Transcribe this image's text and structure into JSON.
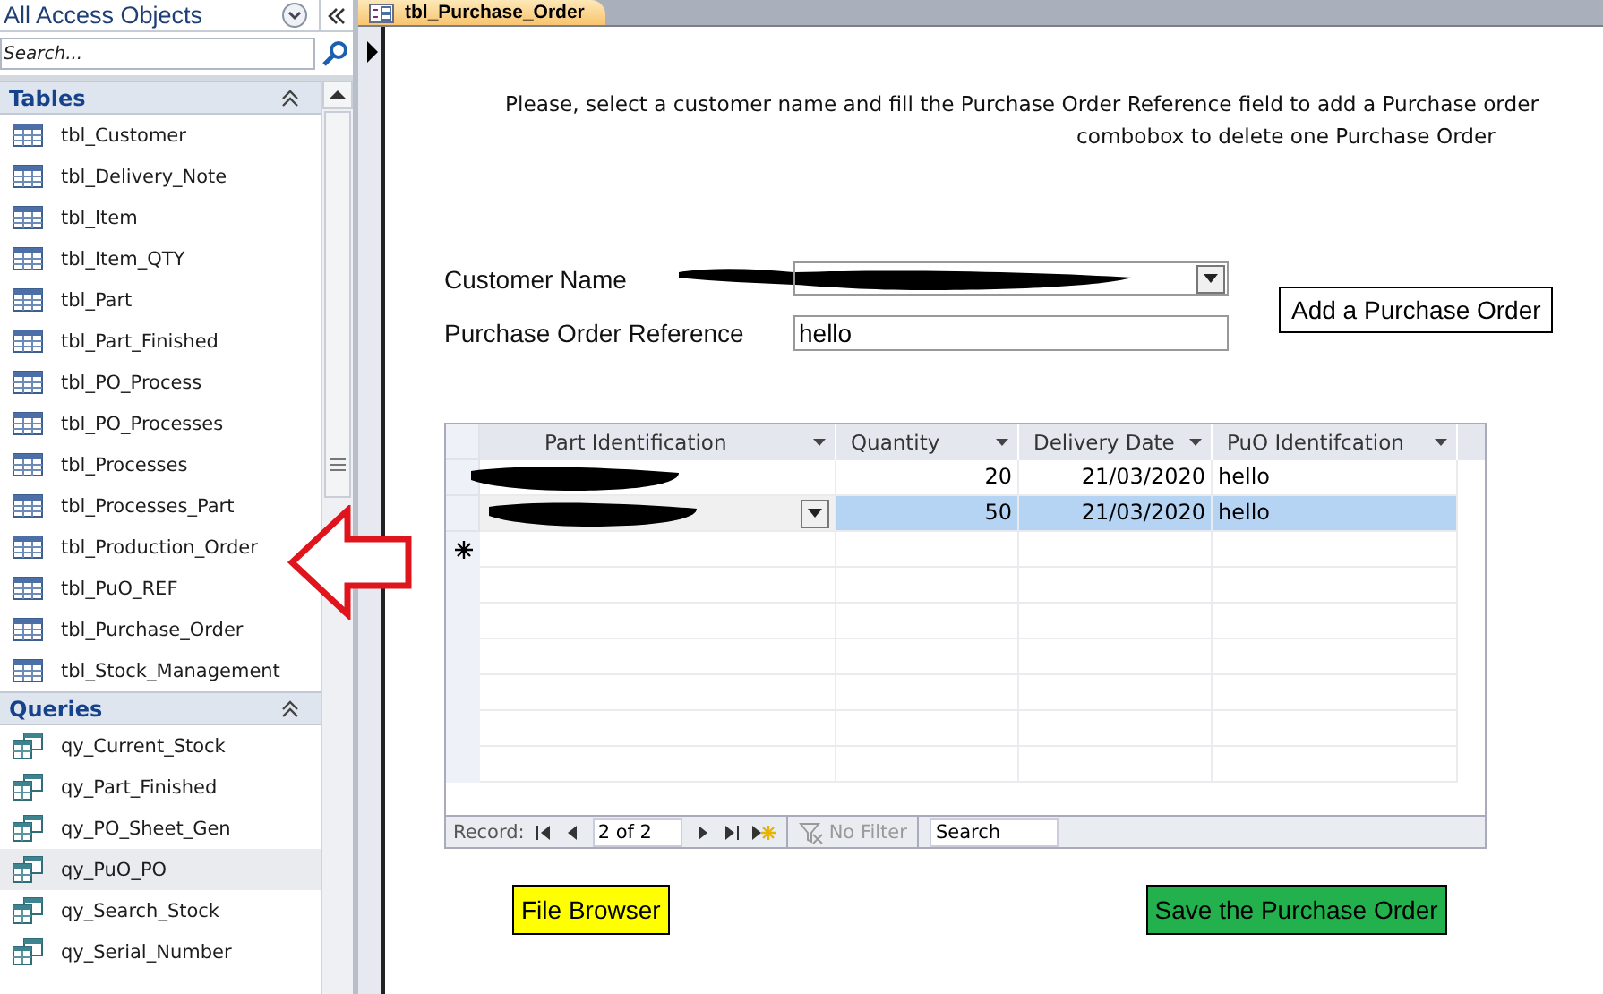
{
  "navigation_pane": {
    "title": "All Access Objects",
    "search": {
      "placeholder": "Search..."
    },
    "groups": [
      {
        "title": "Tables",
        "kind": "table",
        "items": [
          {
            "label": "tbl_Customer",
            "selected": false
          },
          {
            "label": "tbl_Delivery_Note",
            "selected": false
          },
          {
            "label": "tbl_Item",
            "selected": false
          },
          {
            "label": "tbl_Item_QTY",
            "selected": false
          },
          {
            "label": "tbl_Part",
            "selected": false
          },
          {
            "label": "tbl_Part_Finished",
            "selected": false
          },
          {
            "label": "tbl_PO_Process",
            "selected": false
          },
          {
            "label": "tbl_PO_Processes",
            "selected": false
          },
          {
            "label": "tbl_Processes",
            "selected": false
          },
          {
            "label": "tbl_Processes_Part",
            "selected": false
          },
          {
            "label": "tbl_Production_Order",
            "selected": false
          },
          {
            "label": "tbl_PuO_REF",
            "selected": false
          },
          {
            "label": "tbl_Purchase_Order",
            "selected": false
          },
          {
            "label": "tbl_Stock_Management",
            "selected": false
          }
        ]
      },
      {
        "title": "Queries",
        "kind": "query",
        "items": [
          {
            "label": "qy_Current_Stock",
            "selected": false
          },
          {
            "label": "qy_Part_Finished",
            "selected": false
          },
          {
            "label": "qy_PO_Sheet_Gen",
            "selected": false
          },
          {
            "label": "qy_PuO_PO",
            "selected": true
          },
          {
            "label": "qy_Search_Stock",
            "selected": false
          },
          {
            "label": "qy_Serial_Number",
            "selected": false
          }
        ]
      }
    ]
  },
  "document_tab": {
    "label": "tbl_Purchase_Order",
    "selected": true
  },
  "form": {
    "instructions": [
      "Please, select a customer name and fill the Purchase Order Reference field to add a Purchase order",
      "combobox to delete one Purchase Order"
    ],
    "fields": [
      {
        "label": "Customer Name",
        "kind": "combobox",
        "redacted": true
      },
      {
        "label": "Purchase Order Reference",
        "kind": "text",
        "value": "hello"
      }
    ],
    "add_button": "Add a Purchase Order",
    "datasheet": {
      "columns": [
        "Part Identification",
        "Quantity",
        "Delivery Date",
        "PuO Identifcation"
      ],
      "rows": [
        {
          "selected": false,
          "part_redacted": true,
          "quantity": "20",
          "delivery_date": "21/03/2020",
          "puo_identification": "hello"
        },
        {
          "selected": true,
          "part_redacted": true,
          "quantity": "50",
          "delivery_date": "21/03/2020",
          "puo_identification": "hello"
        }
      ],
      "navigation": {
        "label": "Record:",
        "position": "2 of 2",
        "filter": {
          "label": "No Filter",
          "disabled": true
        },
        "search": {
          "placeholder": "Search"
        }
      }
    },
    "buttons": [
      {
        "label": "File Browser",
        "color": "#ffff00"
      },
      {
        "label": "Save the Purchase Order",
        "color": "#22b14c"
      }
    ]
  }
}
